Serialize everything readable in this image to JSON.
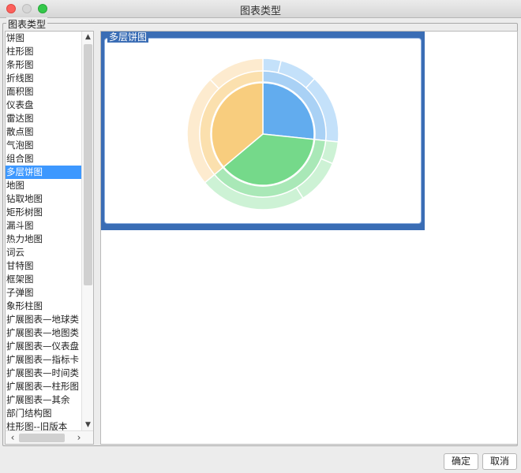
{
  "window": {
    "title": "图表类型"
  },
  "group": {
    "label": "图表类型"
  },
  "chart_types": [
    "饼图",
    "柱形图",
    "条形图",
    "折线图",
    "面积图",
    "仪表盘",
    "雷达图",
    "散点图",
    "气泡图",
    "组合图",
    "多层饼图",
    "地图",
    "钻取地图",
    "矩形树图",
    "漏斗图",
    "热力地图",
    "词云",
    "甘特图",
    "框架图",
    "子弹图",
    "象形柱图",
    "扩展图表—地球类",
    "扩展图表—地图类",
    "扩展图表—仪表盘",
    "扩展图表—指标卡",
    "扩展图表—时间类",
    "扩展图表—柱形图",
    "扩展图表—其余",
    "部门结构图",
    "柱形图--旧版本"
  ],
  "selected_index": 10,
  "preview": {
    "label": "多层饼图",
    "rings": {
      "inner": [
        {
          "start": 0,
          "end": 96,
          "color": "#62acee"
        },
        {
          "start": 96,
          "end": 230,
          "color": "#75d98a"
        },
        {
          "start": 230,
          "end": 360,
          "color": "#f8cd7e"
        }
      ],
      "middle": [
        {
          "start": 0,
          "end": 96,
          "color": "#a9d1f5"
        },
        {
          "start": 96,
          "end": 230,
          "color": "#a9e8b7"
        },
        {
          "start": 230,
          "end": 360,
          "color": "#fbe0ae"
        }
      ],
      "outer": [
        {
          "start": 0,
          "end": 14,
          "color": "#c4e1fa"
        },
        {
          "start": 14,
          "end": 43,
          "color": "#c4e1fa"
        },
        {
          "start": 43,
          "end": 96,
          "color": "#c4e1fa"
        },
        {
          "start": 96,
          "end": 113,
          "color": "#cdf2d5"
        },
        {
          "start": 113,
          "end": 148,
          "color": "#cdf2d5"
        },
        {
          "start": 148,
          "end": 230,
          "color": "#cdf2d5"
        },
        {
          "start": 230,
          "end": 316,
          "color": "#fdebcf"
        },
        {
          "start": 316,
          "end": 360,
          "color": "#fdebcf"
        }
      ]
    }
  },
  "buttons": {
    "ok": "确定",
    "cancel": "取消"
  }
}
